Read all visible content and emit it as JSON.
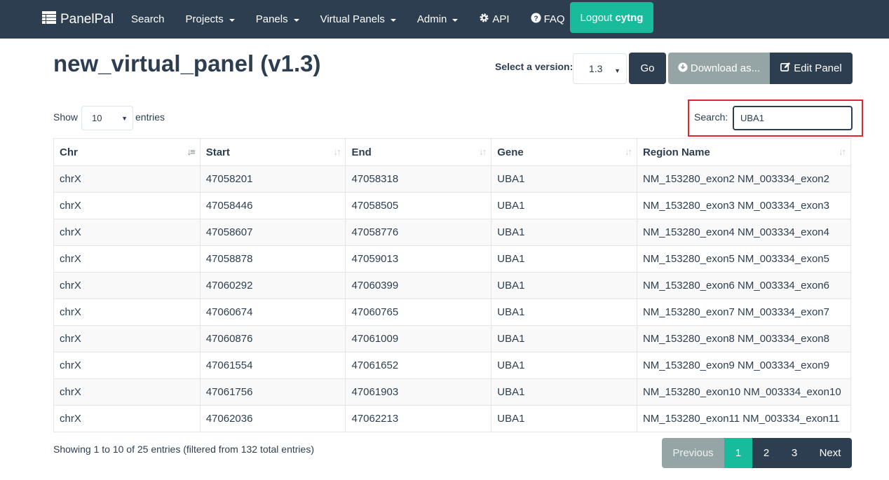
{
  "navbar": {
    "brand": "PanelPal",
    "items": [
      {
        "label": "Search",
        "dropdown": false
      },
      {
        "label": "Projects",
        "dropdown": true
      },
      {
        "label": "Panels",
        "dropdown": true
      },
      {
        "label": "Virtual Panels",
        "dropdown": true
      },
      {
        "label": "Admin",
        "dropdown": true
      },
      {
        "label": "API",
        "icon": "gear-icon"
      },
      {
        "label": "FAQ",
        "icon": "question-circle-icon"
      }
    ],
    "logout_label": "Logout",
    "username": "cytng"
  },
  "page": {
    "title": "new_virtual_panel (v1.3)",
    "version_label": "Select a version:",
    "version_value": "1.3",
    "go_label": "Go",
    "download_label": "Download as...",
    "edit_label": "Edit Panel"
  },
  "table_controls": {
    "show_label": "Show",
    "length_value": "10",
    "entries_label": "entries",
    "search_label": "Search:",
    "search_value": "UBA1"
  },
  "table": {
    "columns": [
      "Chr",
      "Start",
      "End",
      "Gene",
      "Region Name"
    ],
    "rows": [
      [
        "chrX",
        "47058201",
        "47058318",
        "UBA1",
        "NM_153280_exon2 NM_003334_exon2"
      ],
      [
        "chrX",
        "47058446",
        "47058505",
        "UBA1",
        "NM_153280_exon3 NM_003334_exon3"
      ],
      [
        "chrX",
        "47058607",
        "47058776",
        "UBA1",
        "NM_153280_exon4 NM_003334_exon4"
      ],
      [
        "chrX",
        "47058878",
        "47059013",
        "UBA1",
        "NM_153280_exon5 NM_003334_exon5"
      ],
      [
        "chrX",
        "47060292",
        "47060399",
        "UBA1",
        "NM_153280_exon6 NM_003334_exon6"
      ],
      [
        "chrX",
        "47060674",
        "47060765",
        "UBA1",
        "NM_153280_exon7 NM_003334_exon7"
      ],
      [
        "chrX",
        "47060876",
        "47061009",
        "UBA1",
        "NM_153280_exon8 NM_003334_exon8"
      ],
      [
        "chrX",
        "47061554",
        "47061652",
        "UBA1",
        "NM_153280_exon9 NM_003334_exon9"
      ],
      [
        "chrX",
        "47061756",
        "47061903",
        "UBA1",
        "NM_153280_exon10 NM_003334_exon10"
      ],
      [
        "chrX",
        "47062036",
        "47062213",
        "UBA1",
        "NM_153280_exon11 NM_003334_exon11"
      ]
    ]
  },
  "footer": {
    "info": "Showing 1 to 10 of 25 entries (filtered from 132 total entries)",
    "pagination": {
      "previous": "Previous",
      "pages": [
        "1",
        "2",
        "3"
      ],
      "active_page": "1",
      "next": "Next"
    }
  },
  "colors": {
    "navbar": "#2c3e50",
    "accent": "#18bc9c",
    "muted_button": "#95a5a6",
    "highlight_box": "#e0262b"
  }
}
